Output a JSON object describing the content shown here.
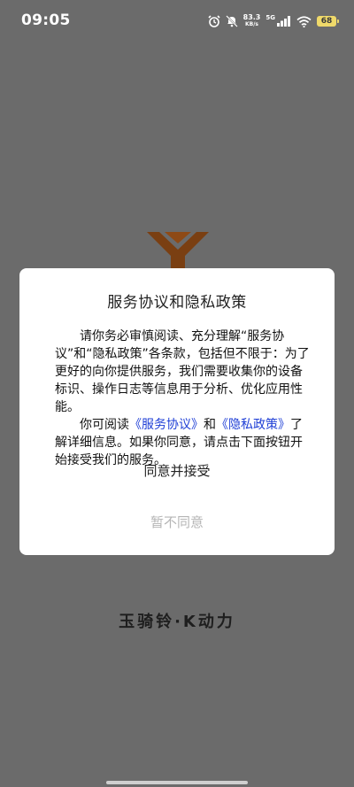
{
  "status_bar": {
    "time": "09:05",
    "net_speed_value": "83.3",
    "net_speed_unit": "KB/s",
    "signal_label": "5G",
    "battery_level": "68",
    "icons": [
      "alarm-icon",
      "mute-icon",
      "signal-icon",
      "wifi-icon",
      "battery-icon"
    ]
  },
  "logo": {
    "icon": "brand-logo",
    "color": "#7a3f12"
  },
  "dialog": {
    "title": "服务协议和隐私政策",
    "paragraph1": "请你务必审慎阅读、充分理解“服务协议”和“隐私政策”各条款，包括但不限于：为了更好的向你提供服务，我们需要收集你的设备标识、操作日志等信息用于分析、优化应用性能。",
    "paragraph2_prefix": "你可阅读",
    "service_link": "《服务协议》",
    "and_text": "和",
    "privacy_link": "《隐私政策》",
    "paragraph2_suffix": "了解详细信息。如果你同意，请点击下面按钮开始接受我们的服务。",
    "agree_button": "同意并接受",
    "disagree_button": "暂不同意",
    "link_color": "#1f3fd6"
  },
  "footer": {
    "brand": "玉骑铃·K动力"
  }
}
